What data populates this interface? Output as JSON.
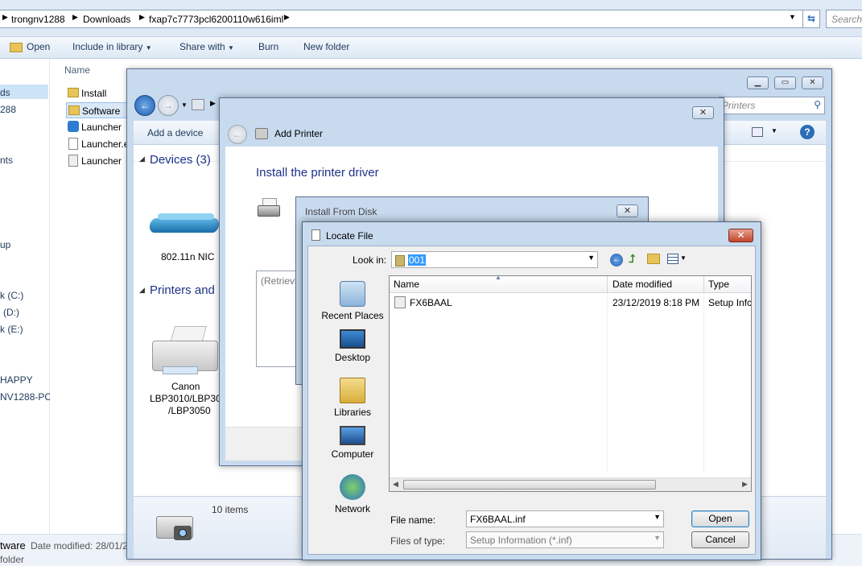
{
  "explorer": {
    "breadcrumb": [
      "trongnv1288",
      "Downloads",
      "fxap7c7773pcl6200110w616iml"
    ],
    "search_placeholder": "Search",
    "toolbar": [
      "Open",
      "Include in library",
      "Share with",
      "Burn",
      "New folder"
    ],
    "nav_items": [
      "ds",
      "288",
      "nts",
      "up",
      "k (C:)",
      "(D:)",
      "k (E:)",
      "HAPPY",
      "NV1288-PC"
    ],
    "column_name": "Name",
    "files": [
      "Install",
      "Software",
      "Launcher",
      "Launcher.e",
      "Launcher"
    ],
    "status_name": "tware",
    "status_modified": "Date modified: 28/01/2",
    "status_type": "folder"
  },
  "devices": {
    "search_placeholder": "Printers",
    "add_device": "Add a device",
    "section_devices": "Devices (3)",
    "device1": "802.11n NIC",
    "section_printers": "Printers and F",
    "printer1_line1": "Canon",
    "printer1_line2": "LBP3010/LBP301",
    "printer1_line3": "/LBP3050",
    "items_count": "10 items"
  },
  "add_printer": {
    "title": "Add Printer",
    "heading": "Install the printer driver",
    "retrieving": "(Retrievi"
  },
  "install_from_disk": {
    "title": "Install From Disk"
  },
  "locate_file": {
    "title": "Locate File",
    "look_in_label": "Look in:",
    "look_in_value": "001",
    "places": [
      "Recent Places",
      "Desktop",
      "Libraries",
      "Computer",
      "Network"
    ],
    "columns": [
      "Name",
      "Date modified",
      "Type"
    ],
    "rows": [
      {
        "name": "FX6BAAL",
        "modified": "23/12/2019 8:18 PM",
        "type": "Setup Infc"
      }
    ],
    "file_name_label": "File name:",
    "file_name_value": "FX6BAAL.inf",
    "files_of_type_label": "Files of type:",
    "files_of_type_value": "Setup Information (*.inf)",
    "open_button": "Open",
    "cancel_button": "Cancel"
  },
  "colors": {
    "title_text": "#1e3287",
    "link_blue": "#1e395b",
    "close_red": "#c3452b"
  }
}
